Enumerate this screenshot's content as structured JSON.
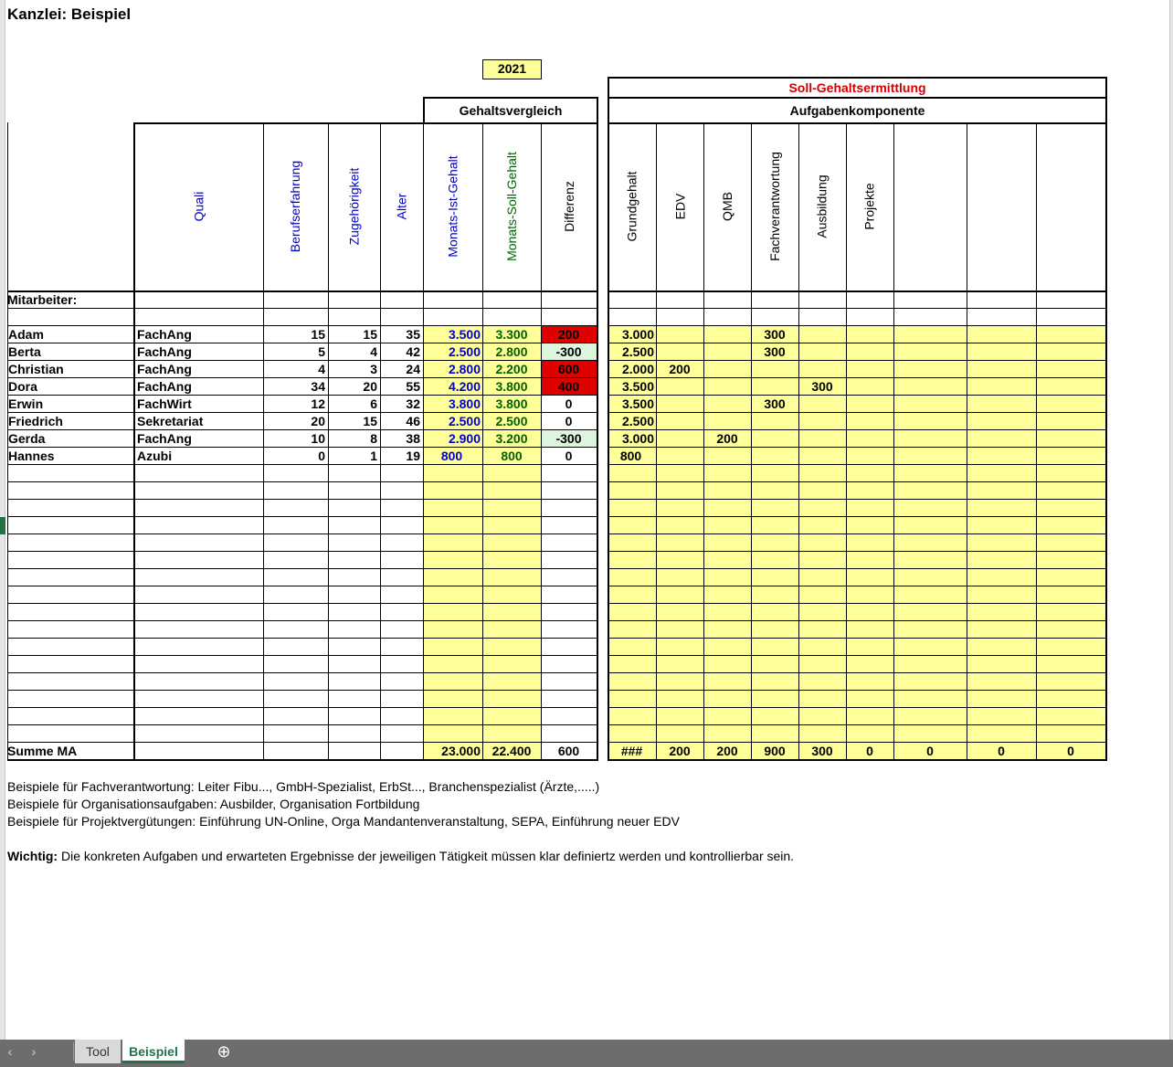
{
  "title": "Kanzlei: Beispiel",
  "year": "2021",
  "headers": {
    "soll_gehaltsermittlung": "Soll-Gehaltsermittlung",
    "gehaltsvergleich": "Gehaltsvergleich",
    "aufgabenkomponente": "Aufgabenkomponente",
    "mitarbeiter": "Mitarbeiter:",
    "summe": "Summe MA",
    "columns": {
      "quali": "Quali",
      "berufserfahrung": "Berufserfahrung",
      "zugehoerigkeit": "Zugehörigkeit",
      "alter": "Alter",
      "ist": "Monats-Ist-Gehalt",
      "soll": "Monats-Soll-Gehalt",
      "differenz": "Differenz",
      "grundgehalt": "Grundgehalt",
      "edv": "EDV",
      "qmb": "QMB",
      "fachverantwortung": "Fachverantwortung",
      "ausbildung": "Ausbildung",
      "projekte": "Projekte"
    }
  },
  "rows": [
    {
      "name": "Adam",
      "quali": "FachAng",
      "beruf": "15",
      "zug": "15",
      "alter": "35",
      "ist": "3.500",
      "soll": "3.300",
      "diff": "200",
      "grund": "3.000",
      "edv": "",
      "qmb": "",
      "fach": "300",
      "ausb": "",
      "proj": ""
    },
    {
      "name": "Berta",
      "quali": "FachAng",
      "beruf": "5",
      "zug": "4",
      "alter": "42",
      "ist": "2.500",
      "soll": "2.800",
      "diff": "-300",
      "grund": "2.500",
      "edv": "",
      "qmb": "",
      "fach": "300",
      "ausb": "",
      "proj": ""
    },
    {
      "name": "Christian",
      "quali": "FachAng",
      "beruf": "4",
      "zug": "3",
      "alter": "24",
      "ist": "2.800",
      "soll": "2.200",
      "diff": "600",
      "grund": "2.000",
      "edv": "200",
      "qmb": "",
      "fach": "",
      "ausb": "",
      "proj": ""
    },
    {
      "name": "Dora",
      "quali": "FachAng",
      "beruf": "34",
      "zug": "20",
      "alter": "55",
      "ist": "4.200",
      "soll": "3.800",
      "diff": "400",
      "grund": "3.500",
      "edv": "",
      "qmb": "",
      "fach": "",
      "ausb": "300",
      "proj": ""
    },
    {
      "name": "Erwin",
      "quali": "FachWirt",
      "beruf": "12",
      "zug": "6",
      "alter": "32",
      "ist": "3.800",
      "soll": "3.800",
      "diff": "0",
      "grund": "3.500",
      "edv": "",
      "qmb": "",
      "fach": "300",
      "ausb": "",
      "proj": ""
    },
    {
      "name": "Friedrich",
      "quali": "Sekretariat",
      "beruf": "20",
      "zug": "15",
      "alter": "46",
      "ist": "2.500",
      "soll": "2.500",
      "diff": "0",
      "grund": "2.500",
      "edv": "",
      "qmb": "",
      "fach": "",
      "ausb": "",
      "proj": ""
    },
    {
      "name": "Gerda",
      "quali": "FachAng",
      "beruf": "10",
      "zug": "8",
      "alter": "38",
      "ist": "2.900",
      "soll": "3.200",
      "diff": "-300",
      "grund": "3.000",
      "edv": "",
      "qmb": "200",
      "fach": "",
      "ausb": "",
      "proj": ""
    },
    {
      "name": "Hannes",
      "quali": "Azubi",
      "beruf": "0",
      "zug": "1",
      "alter": "19",
      "ist": "800",
      "soll": "800",
      "diff": "0",
      "grund": "800",
      "edv": "",
      "qmb": "",
      "fach": "",
      "ausb": "",
      "proj": ""
    }
  ],
  "totals": {
    "ist": "23.000",
    "soll": "22.400",
    "diff": "600",
    "grund": "###",
    "edv": "200",
    "qmb": "200",
    "fach": "900",
    "ausb": "300",
    "proj": "0",
    "x1": "0",
    "x2": "0",
    "x3": "0"
  },
  "notes": [
    "Beispiele für Fachverantwortung: Leiter Fibu..., GmbH-Spezialist, ErbSt..., Branchenspezialist (Ärzte,.....)",
    "Beispiele für Organisationsaufgaben: Ausbilder, Organisation Fortbildung",
    "Beispiele für Projektvergütungen: Einführung UN-Online, Orga Mandantenveranstaltung, SEPA, Einführung neuer EDV"
  ],
  "important_label": "Wichtig:",
  "important_text": " Die konkreten Aufgaben und erwarteten Ergebnisse der jeweiligen Tätigkeit müssen klar definiertz werden und kontrollierbar sein.",
  "tabs": [
    {
      "label": "Tool",
      "active": false
    },
    {
      "label": "Beispiel",
      "active": true
    }
  ],
  "tab_nav": {
    "prev": "‹",
    "next": "›",
    "add": "⊕"
  },
  "colors": {
    "yellow": "#ffff99",
    "red": "#e00000",
    "lightgreen": "#ddf5dd",
    "accent": "#217346",
    "tabbar": "#6d6d6d"
  }
}
